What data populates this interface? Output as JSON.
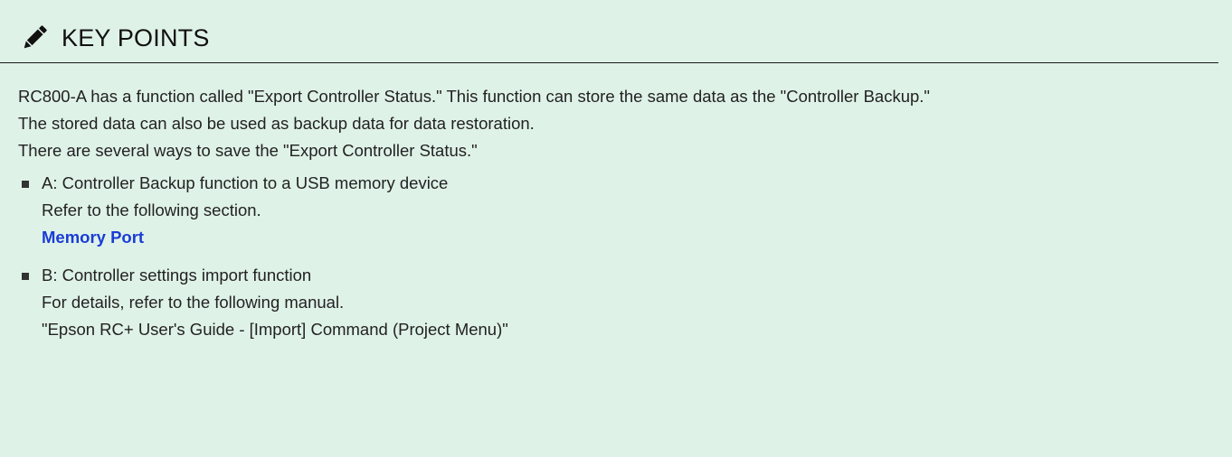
{
  "note": {
    "icon": "pencil-icon",
    "title": "KEY POINTS",
    "paragraphs": [
      "RC800-A has a function called \"Export Controller Status.\" This function can store the same data as the \"Controller Backup.\"",
      "The stored data can also be used as backup data for data restoration.",
      "There are several ways to save the \"Export Controller Status.\""
    ],
    "items": [
      {
        "heading": "A: Controller Backup function to a USB memory device",
        "text": "Refer to the following section.",
        "link": "Memory Port"
      },
      {
        "heading": "B: Controller settings import function",
        "text": "For details, refer to the following manual.",
        "reference": "\"Epson RC+ User's Guide - [Import] Command (Project Menu)\""
      }
    ]
  },
  "colors": {
    "background": "#dff2e8",
    "link": "#1a3cd6",
    "text": "#222222"
  }
}
